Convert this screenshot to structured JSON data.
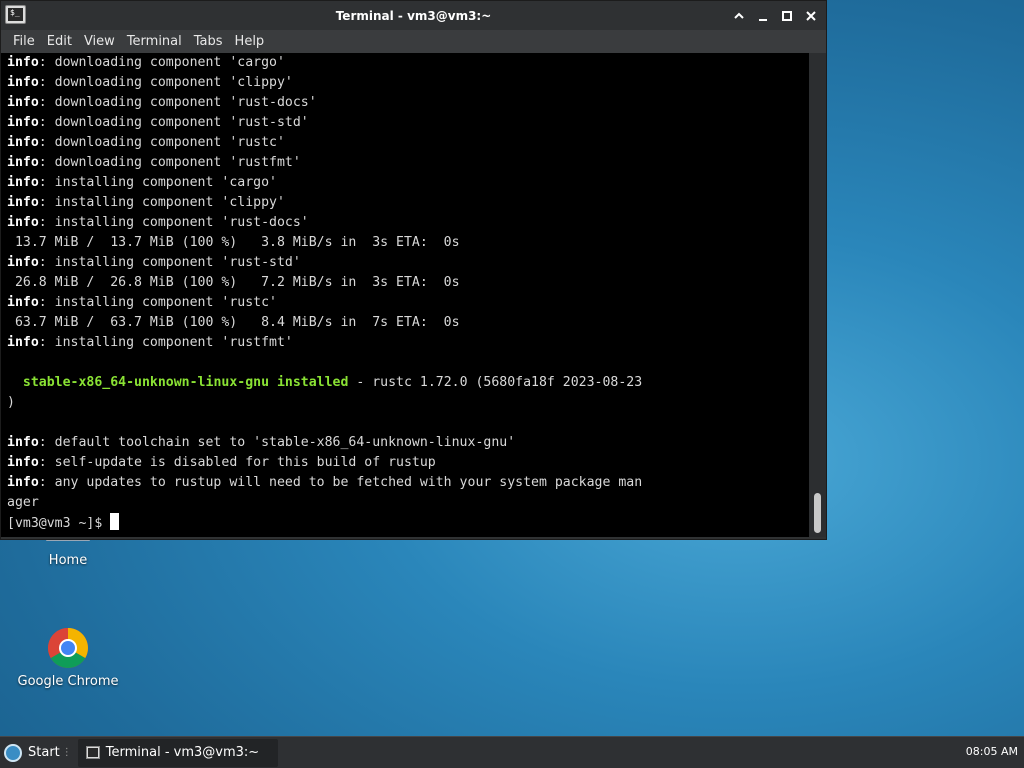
{
  "window": {
    "title": "Terminal - vm3@vm3:~",
    "app_icon_glyph": "$_"
  },
  "menu": [
    "File",
    "Edit",
    "View",
    "Terminal",
    "Tabs",
    "Help"
  ],
  "terminal_lines": [
    [
      {
        "t": "info",
        "c": "kw"
      },
      {
        "t": ": downloading component 'cargo'"
      }
    ],
    [
      {
        "t": "info",
        "c": "kw"
      },
      {
        "t": ": downloading component 'clippy'"
      }
    ],
    [
      {
        "t": "info",
        "c": "kw"
      },
      {
        "t": ": downloading component 'rust-docs'"
      }
    ],
    [
      {
        "t": "info",
        "c": "kw"
      },
      {
        "t": ": downloading component 'rust-std'"
      }
    ],
    [
      {
        "t": "info",
        "c": "kw"
      },
      {
        "t": ": downloading component 'rustc'"
      }
    ],
    [
      {
        "t": "info",
        "c": "kw"
      },
      {
        "t": ": downloading component 'rustfmt'"
      }
    ],
    [
      {
        "t": "info",
        "c": "kw"
      },
      {
        "t": ": installing component 'cargo'"
      }
    ],
    [
      {
        "t": "info",
        "c": "kw"
      },
      {
        "t": ": installing component 'clippy'"
      }
    ],
    [
      {
        "t": "info",
        "c": "kw"
      },
      {
        "t": ": installing component 'rust-docs'"
      }
    ],
    [
      {
        "t": " 13.7 MiB /  13.7 MiB (100 %)   3.8 MiB/s in  3s ETA:  0s"
      }
    ],
    [
      {
        "t": "info",
        "c": "kw"
      },
      {
        "t": ": installing component 'rust-std'"
      }
    ],
    [
      {
        "t": " 26.8 MiB /  26.8 MiB (100 %)   7.2 MiB/s in  3s ETA:  0s"
      }
    ],
    [
      {
        "t": "info",
        "c": "kw"
      },
      {
        "t": ": installing component 'rustc'"
      }
    ],
    [
      {
        "t": " 63.7 MiB /  63.7 MiB (100 %)   8.4 MiB/s in  7s ETA:  0s"
      }
    ],
    [
      {
        "t": "info",
        "c": "kw"
      },
      {
        "t": ": installing component 'rustfmt'"
      }
    ],
    [
      {
        "t": ""
      }
    ],
    [
      {
        "t": "  "
      },
      {
        "t": "stable-x86_64-unknown-linux-gnu installed",
        "c": "grn"
      },
      {
        "t": " - rustc 1.72.0 (5680fa18f 2023-08-23"
      }
    ],
    [
      {
        "t": ")"
      }
    ],
    [
      {
        "t": ""
      }
    ],
    [
      {
        "t": "info",
        "c": "kw"
      },
      {
        "t": ": default toolchain set to 'stable-x86_64-unknown-linux-gnu'"
      }
    ],
    [
      {
        "t": "info",
        "c": "kw"
      },
      {
        "t": ": self-update is disabled for this build of rustup"
      }
    ],
    [
      {
        "t": "info",
        "c": "kw"
      },
      {
        "t": ": any updates to rustup will need to be fetched with your system package man"
      }
    ],
    [
      {
        "t": "ager"
      }
    ]
  ],
  "prompt": "[vm3@vm3 ~]$",
  "desktop": {
    "home_label": "Home",
    "chrome_label": "Google Chrome"
  },
  "taskbar": {
    "start_label": "Start",
    "task_label": "Terminal - vm3@vm3:~",
    "clock": "08:05 AM"
  }
}
